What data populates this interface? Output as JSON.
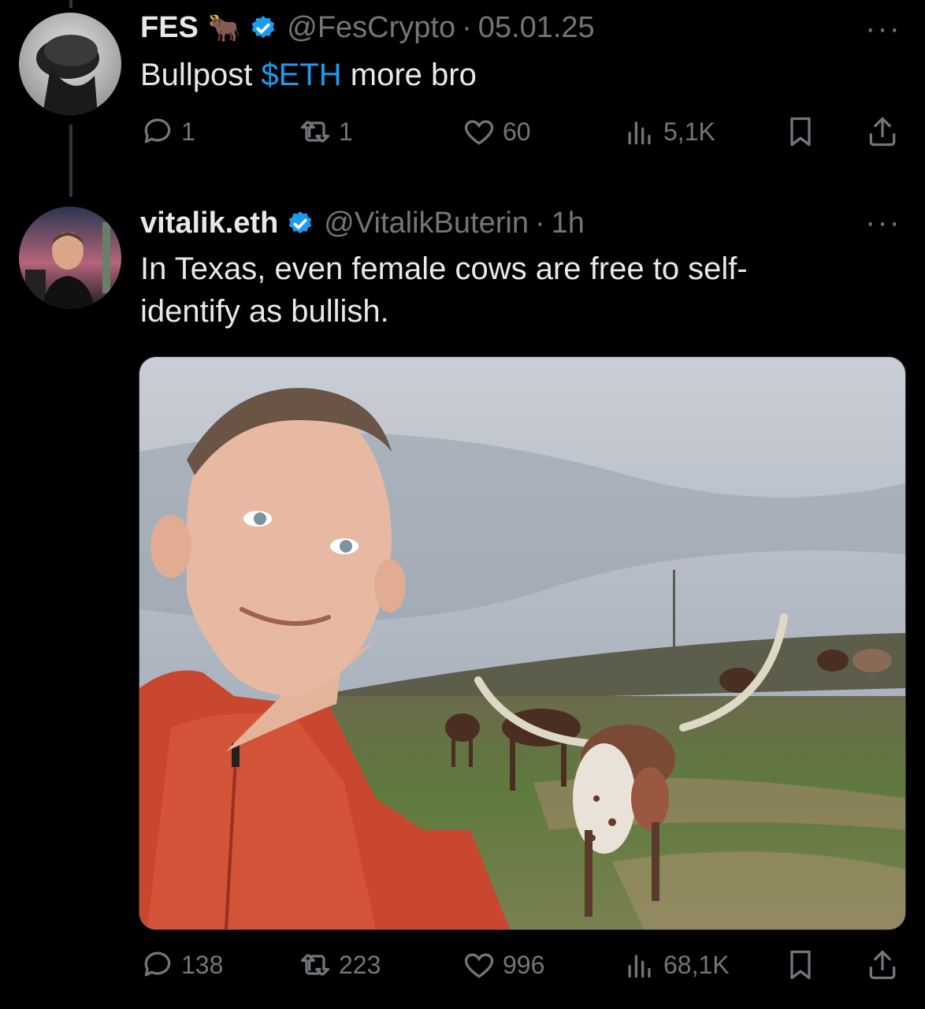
{
  "tweets": [
    {
      "name": "FES",
      "emoji": "🐂",
      "handle": "@FesCrypto",
      "time": "05.01.25",
      "text_before": "Bullpost ",
      "cashtag": "$ETH",
      "text_after": " more bro",
      "replies": "1",
      "reposts": "1",
      "likes": "60",
      "views": "5,1K"
    },
    {
      "name": "vitalik.eth",
      "handle": "@VitalikButerin",
      "time": "1h",
      "text": "In Texas, even female cows are free to self-\nidentify as bullish.",
      "replies": "138",
      "reposts": "223",
      "likes": "996",
      "views": "68,1K"
    }
  ],
  "ui": {
    "more": "···",
    "separator": "·"
  },
  "colors": {
    "accent": "#1d9bf0",
    "muted": "#71767b",
    "text": "#e7e9ea",
    "background": "#000000"
  }
}
